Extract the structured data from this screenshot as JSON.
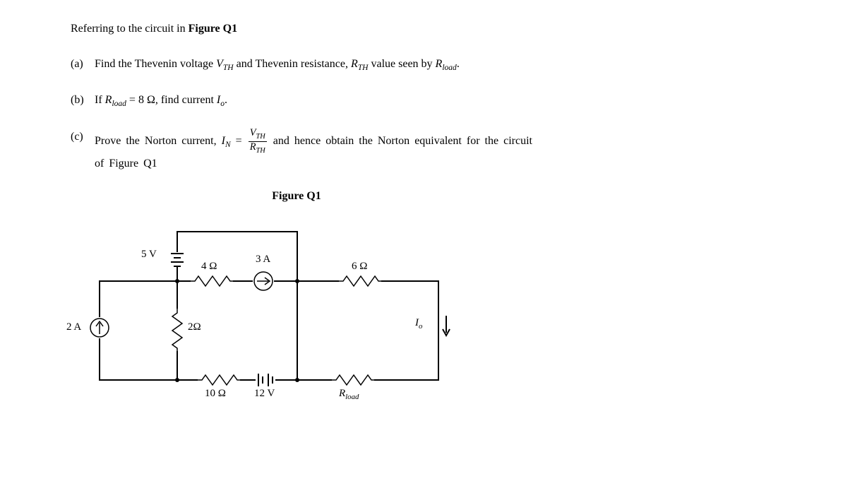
{
  "intro": "Referring to the circuit in ",
  "intro_fig": "Figure Q1",
  "parts": {
    "a": {
      "label": "(a)",
      "t1": "Find the Thevenin voltage ",
      "vth": "V",
      "vth_sub": "TH",
      "t2": " and Thevenin resistance, ",
      "rth": "R",
      "rth_sub": "TH",
      "t3": " value seen by ",
      "rload": "R",
      "rload_sub": "load",
      "t4": "."
    },
    "b": {
      "label": "(b)",
      "t1": "If ",
      "rload": "R",
      "rload_sub": "load",
      "t2": " = 8 Ω, find current ",
      "io": "I",
      "io_sub": "o",
      "t3": "."
    },
    "c": {
      "label": "(c)",
      "t1": "Prove the Norton current, ",
      "in": "I",
      "in_sub": "N",
      "eq": " = ",
      "frac_num_v": "V",
      "frac_num_sub": "TH",
      "frac_den_r": "R",
      "frac_den_sub": "TH",
      "t2": " and hence obtain the Norton equivalent for the circuit of ",
      "fig": "Figure Q1"
    }
  },
  "figure_caption": "Figure Q1",
  "circuit": {
    "src_2A": "2 A",
    "src_5V": "5 V",
    "r_2ohm": "2Ω",
    "r_4ohm": "4 Ω",
    "src_3A": "3 A",
    "r_6ohm": "6 Ω",
    "r_10ohm": "10 Ω",
    "src_12V": "12 V",
    "rload_r": "R",
    "rload_sub": "load",
    "io_i": "I",
    "io_sub": "o"
  }
}
